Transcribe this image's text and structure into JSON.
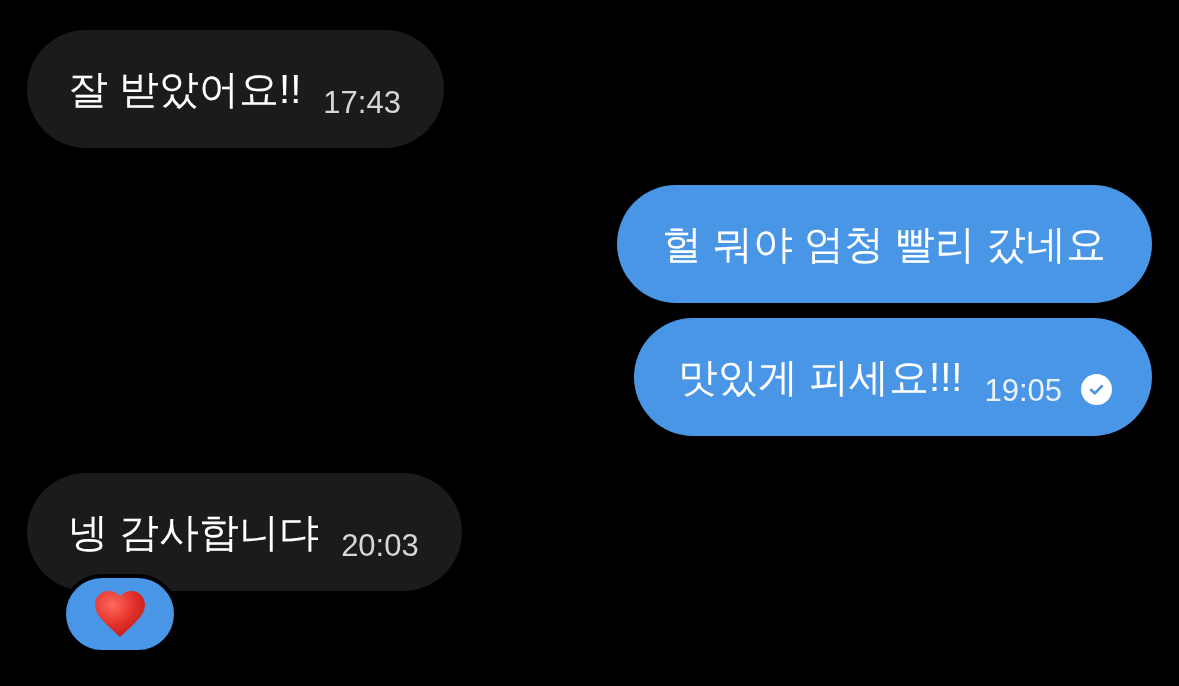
{
  "messages": [
    {
      "kind": "incoming",
      "text": "잘 받았어요!!",
      "time": "17:43"
    },
    {
      "kind": "outgoing",
      "text": "헐 뭐야 엄청 빨리 갔네요"
    },
    {
      "kind": "outgoing",
      "text": "맛있게 피세요!!!",
      "time": "19:05",
      "read": true
    },
    {
      "kind": "incoming",
      "text": "넹 감사합니댜",
      "time": "20:03",
      "reactions": [
        {
          "kind": "heart",
          "selected": true
        }
      ]
    }
  ]
}
